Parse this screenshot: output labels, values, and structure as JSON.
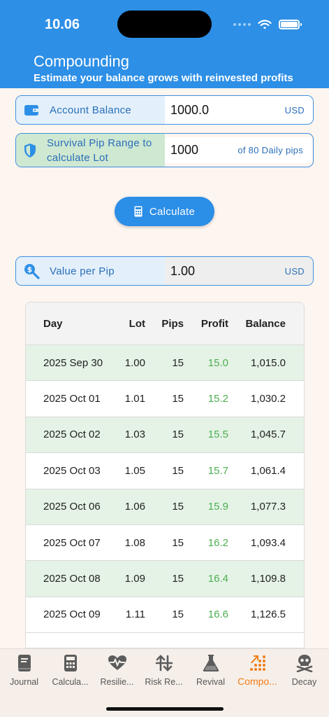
{
  "status_bar": {
    "time": "10.06"
  },
  "header": {
    "title": "Compounding",
    "subtitle": "Estimate your balance grows with reinvested profits"
  },
  "account_balance": {
    "label": "Account Balance",
    "value": "1000.0",
    "suffix": "USD",
    "icon": "wallet-icon"
  },
  "survival_pips": {
    "label": "Survival Pip Range to calculate Lot",
    "value": "1000",
    "suffix": "of 80 Daily pips",
    "icon": "shield-icon"
  },
  "calculate_button": {
    "label": "Calculate",
    "icon": "calculator-icon"
  },
  "value_per_pip": {
    "label": "Value per Pip",
    "value": "1.00",
    "suffix": "USD",
    "icon": "dollar-search-icon"
  },
  "table": {
    "headers": [
      "Day",
      "Lot",
      "Pips",
      "Profit",
      "Balance"
    ],
    "rows": [
      {
        "day": "2025 Sep 30",
        "lot": "1.00",
        "pips": "15",
        "profit": "15.0",
        "balance": "1,015.0"
      },
      {
        "day": "2025 Oct 01",
        "lot": "1.01",
        "pips": "15",
        "profit": "15.2",
        "balance": "1,030.2"
      },
      {
        "day": "2025 Oct 02",
        "lot": "1.03",
        "pips": "15",
        "profit": "15.5",
        "balance": "1,045.7"
      },
      {
        "day": "2025 Oct 03",
        "lot": "1.05",
        "pips": "15",
        "profit": "15.7",
        "balance": "1,061.4"
      },
      {
        "day": "2025 Oct 06",
        "lot": "1.06",
        "pips": "15",
        "profit": "15.9",
        "balance": "1,077.3"
      },
      {
        "day": "2025 Oct 07",
        "lot": "1.08",
        "pips": "15",
        "profit": "16.2",
        "balance": "1,093.4"
      },
      {
        "day": "2025 Oct 08",
        "lot": "1.09",
        "pips": "15",
        "profit": "16.4",
        "balance": "1,109.8"
      },
      {
        "day": "2025 Oct 09",
        "lot": "1.11",
        "pips": "15",
        "profit": "16.6",
        "balance": "1,126.5"
      }
    ]
  },
  "bottom_nav": [
    {
      "label": "Journal",
      "icon": "book-icon",
      "active": false
    },
    {
      "label": "Calcula...",
      "icon": "calculator-icon",
      "active": false
    },
    {
      "label": "Resilie...",
      "icon": "heartbeat-icon",
      "active": false
    },
    {
      "label": "Risk Re...",
      "icon": "swap-arrows-icon",
      "active": false
    },
    {
      "label": "Revival",
      "icon": "flask-icon",
      "active": false
    },
    {
      "label": "Compo...",
      "icon": "trend-dots-icon",
      "active": true
    },
    {
      "label": "Decay",
      "icon": "skull-crossbones-icon",
      "active": false
    }
  ],
  "colors": {
    "primary": "#2d8fe6",
    "accent_orange": "#ef7d17",
    "profit_green": "#4caf50",
    "row_alt": "#e5f3e6",
    "background": "#fdf5ef"
  }
}
